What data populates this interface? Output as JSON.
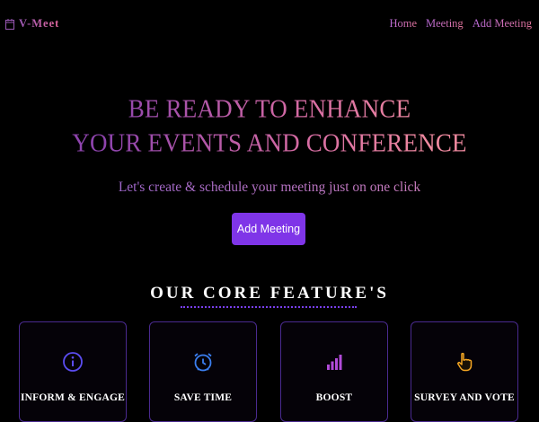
{
  "header": {
    "brand": "V-Meet",
    "brand_icon": "calendar-icon",
    "nav": [
      "Home",
      "Meeting",
      "Add Meeting"
    ]
  },
  "hero": {
    "title_line1": "BE READY TO ENHANCE",
    "title_line2": "YOUR EVENTS AND CONFERENCE",
    "subtitle": "Let's create & schedule your meeting just on one click",
    "cta_label": "Add Meeting"
  },
  "features": {
    "title": "OUR CORE FEATURE'S",
    "cards": [
      {
        "label": "INFORM & ENGAGE",
        "icon": "info-icon"
      },
      {
        "label": "SAVE TIME",
        "icon": "alarm-clock-icon"
      },
      {
        "label": "BOOST",
        "icon": "signal-bars-icon"
      },
      {
        "label": "SURVEY AND VOTE",
        "icon": "pointing-hand-icon"
      }
    ]
  },
  "colors": {
    "background": "#000000",
    "accent": "#7f35e8",
    "card_border": "#4a2a8f",
    "info_icon": "#5b4cf0",
    "clock_icon": "#3b7ff0",
    "bars_icon": "#b14bd8",
    "hand_icon": "#f5a623"
  }
}
